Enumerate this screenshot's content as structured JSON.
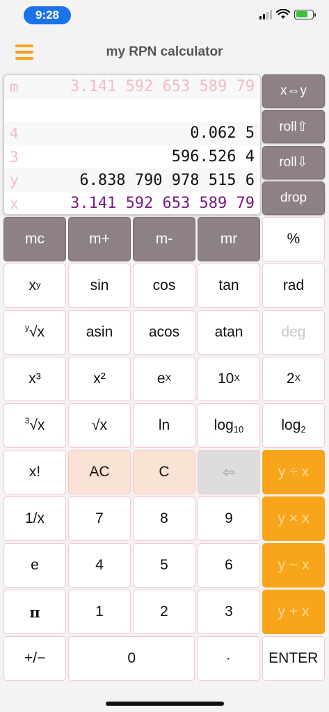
{
  "status": {
    "time": "9:28"
  },
  "header": {
    "title": "my RPN calculator"
  },
  "stack": {
    "m": {
      "label": "m",
      "value": "3.141 592 653 589 79"
    },
    "empty": {
      "label": "",
      "value": ""
    },
    "r4": {
      "label": "4",
      "value": "0.062 5"
    },
    "r3": {
      "label": "3",
      "value": "596.526 4"
    },
    "y": {
      "label": "y",
      "value": "6.838 790 978 515 6"
    },
    "x": {
      "label": "x",
      "value": "3.141 592 653 589 79"
    }
  },
  "stack_ops": {
    "swap": "x⇔y",
    "roll_up": "roll⇧",
    "roll_down": "roll⇩",
    "drop": "drop"
  },
  "keys": {
    "mc": "mc",
    "mplus": "m+",
    "mminus": "m-",
    "mr": "mr",
    "percent": "%",
    "pow_base": "x",
    "pow_exp": "y",
    "sin": "sin",
    "cos": "cos",
    "tan": "tan",
    "rad": "rad",
    "root_index": "y",
    "root_body": "√x",
    "asin": "asin",
    "acos": "acos",
    "atan": "atan",
    "deg": "deg",
    "cube": "x³",
    "square": "x²",
    "exp_base": "e",
    "exp_sup": "X",
    "ten_base": "10",
    "ten_sup": "X",
    "two_base": "2",
    "two_sup": "X",
    "cbrt_index": "3",
    "cbrt_body": "√x",
    "sqrt": "√x",
    "ln": "ln",
    "log10_base": "log",
    "log10_sub": "10",
    "log2_base": "log",
    "log2_sub": "2",
    "fact": "x!",
    "ac": "AC",
    "c": "C",
    "backspace": "⇦",
    "divide": "y ÷ x",
    "inv": "1/x",
    "n7": "7",
    "n8": "8",
    "n9": "9",
    "multiply": "y × x",
    "e": "e",
    "n4": "4",
    "n5": "5",
    "n6": "6",
    "subtract": "y − x",
    "pi": "π",
    "n1": "1",
    "n2": "2",
    "n3": "3",
    "add": "y + x",
    "negate": "+/−",
    "n0": "0",
    "dot": "·",
    "enter": "ENTER"
  },
  "colors": {
    "accent": "#f9a51c",
    "memory": "#8e8185",
    "x_value": "#7a1a82",
    "m_value": "#f2bcc6",
    "time_pill": "#1a73e8"
  }
}
